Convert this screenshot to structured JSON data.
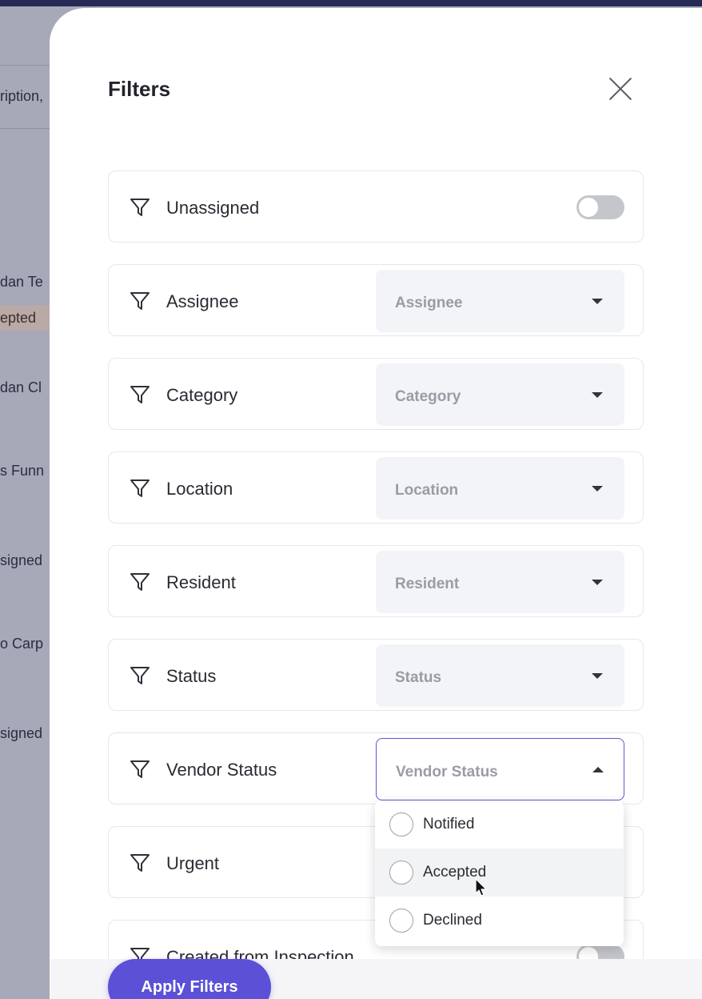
{
  "background": {
    "snippets": [
      "ription,",
      "dan Te",
      "dan Cl",
      "s Funn",
      "signed",
      "o Carp",
      "signed"
    ],
    "badge": "epted"
  },
  "modal": {
    "title": "Filters",
    "apply_label": "Apply Filters"
  },
  "filters": {
    "unassigned": {
      "label": "Unassigned",
      "toggle_on": false
    },
    "assignee": {
      "label": "Assignee",
      "placeholder": "Assignee"
    },
    "category": {
      "label": "Category",
      "placeholder": "Category"
    },
    "location": {
      "label": "Location",
      "placeholder": "Location"
    },
    "resident": {
      "label": "Resident",
      "placeholder": "Resident"
    },
    "status": {
      "label": "Status",
      "placeholder": "Status"
    },
    "vendor_status": {
      "label": "Vendor Status",
      "placeholder": "Vendor Status",
      "open": true
    },
    "urgent": {
      "label": "Urgent"
    },
    "created_from_inspection": {
      "label": "Created from Inspection",
      "toggle_on": false
    }
  },
  "vendor_status_options": [
    "Notified",
    "Accepted",
    "Declined"
  ],
  "hovered_option": "Accepted",
  "colors": {
    "accent": "#5b50d6",
    "topbar": "#262a55",
    "focus_border": "#5c58d1"
  },
  "icons": {
    "filter": "filter-funnel-icon",
    "close": "close-icon",
    "caret": "caret-icon",
    "cursor": "mouse-pointer-icon"
  }
}
